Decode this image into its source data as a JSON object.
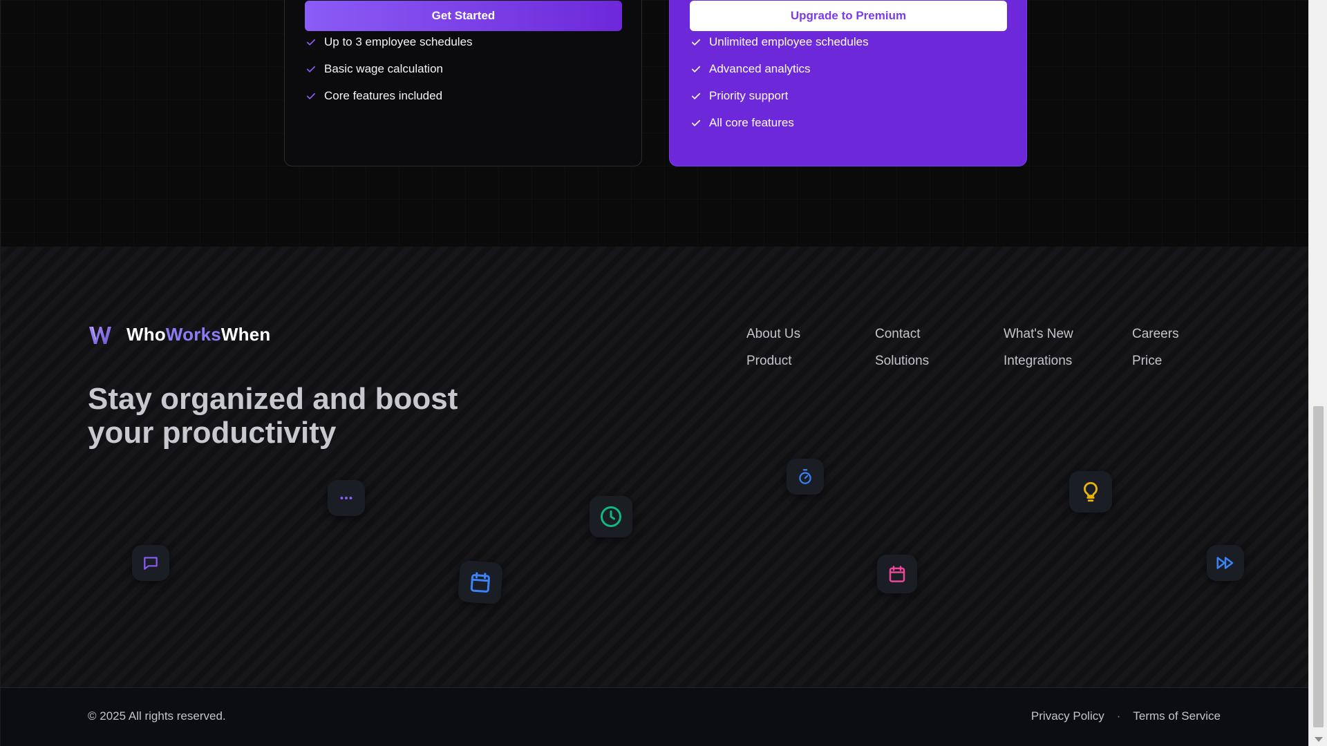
{
  "pricing": {
    "free": {
      "button_label": "Get Started",
      "features": [
        "Up to 3 employee schedules",
        "Basic wage calculation",
        "Core features included"
      ]
    },
    "premium": {
      "button_label": "Upgrade to Premium",
      "features": [
        "Unlimited employee schedules",
        "Advanced analytics",
        "Priority support",
        "All core features"
      ]
    }
  },
  "footer": {
    "brand": {
      "part1": "Who",
      "part2": "Works",
      "part3": "When"
    },
    "tagline": "Stay organized and boost your productivity",
    "nav": [
      "About Us",
      "Contact",
      "What's New",
      "Careers",
      "Product",
      "Solutions",
      "Integrations",
      "Price"
    ],
    "floating_icons": [
      {
        "name": "chat-icon",
        "color": "#8b5cf6"
      },
      {
        "name": "more-dots-icon",
        "color": "#8b5cf6"
      },
      {
        "name": "calendar-icon",
        "color": "#3b82f6"
      },
      {
        "name": "clock-icon",
        "color": "#10b981"
      },
      {
        "name": "stopwatch-icon",
        "color": "#3b82f6"
      },
      {
        "name": "calendar-icon",
        "color": "#ec4899"
      },
      {
        "name": "lightbulb-icon",
        "color": "#eab308"
      },
      {
        "name": "fast-forward-icon",
        "color": "#3b82f6"
      }
    ]
  },
  "bottom": {
    "copyright": "© 2025 All rights reserved.",
    "privacy": "Privacy Policy",
    "separator": "·",
    "terms": "Terms of Service"
  },
  "colors": {
    "accent": "#7c3aed",
    "premium_card": "#6d28d9",
    "brand_accent": "#8b7cf6"
  }
}
